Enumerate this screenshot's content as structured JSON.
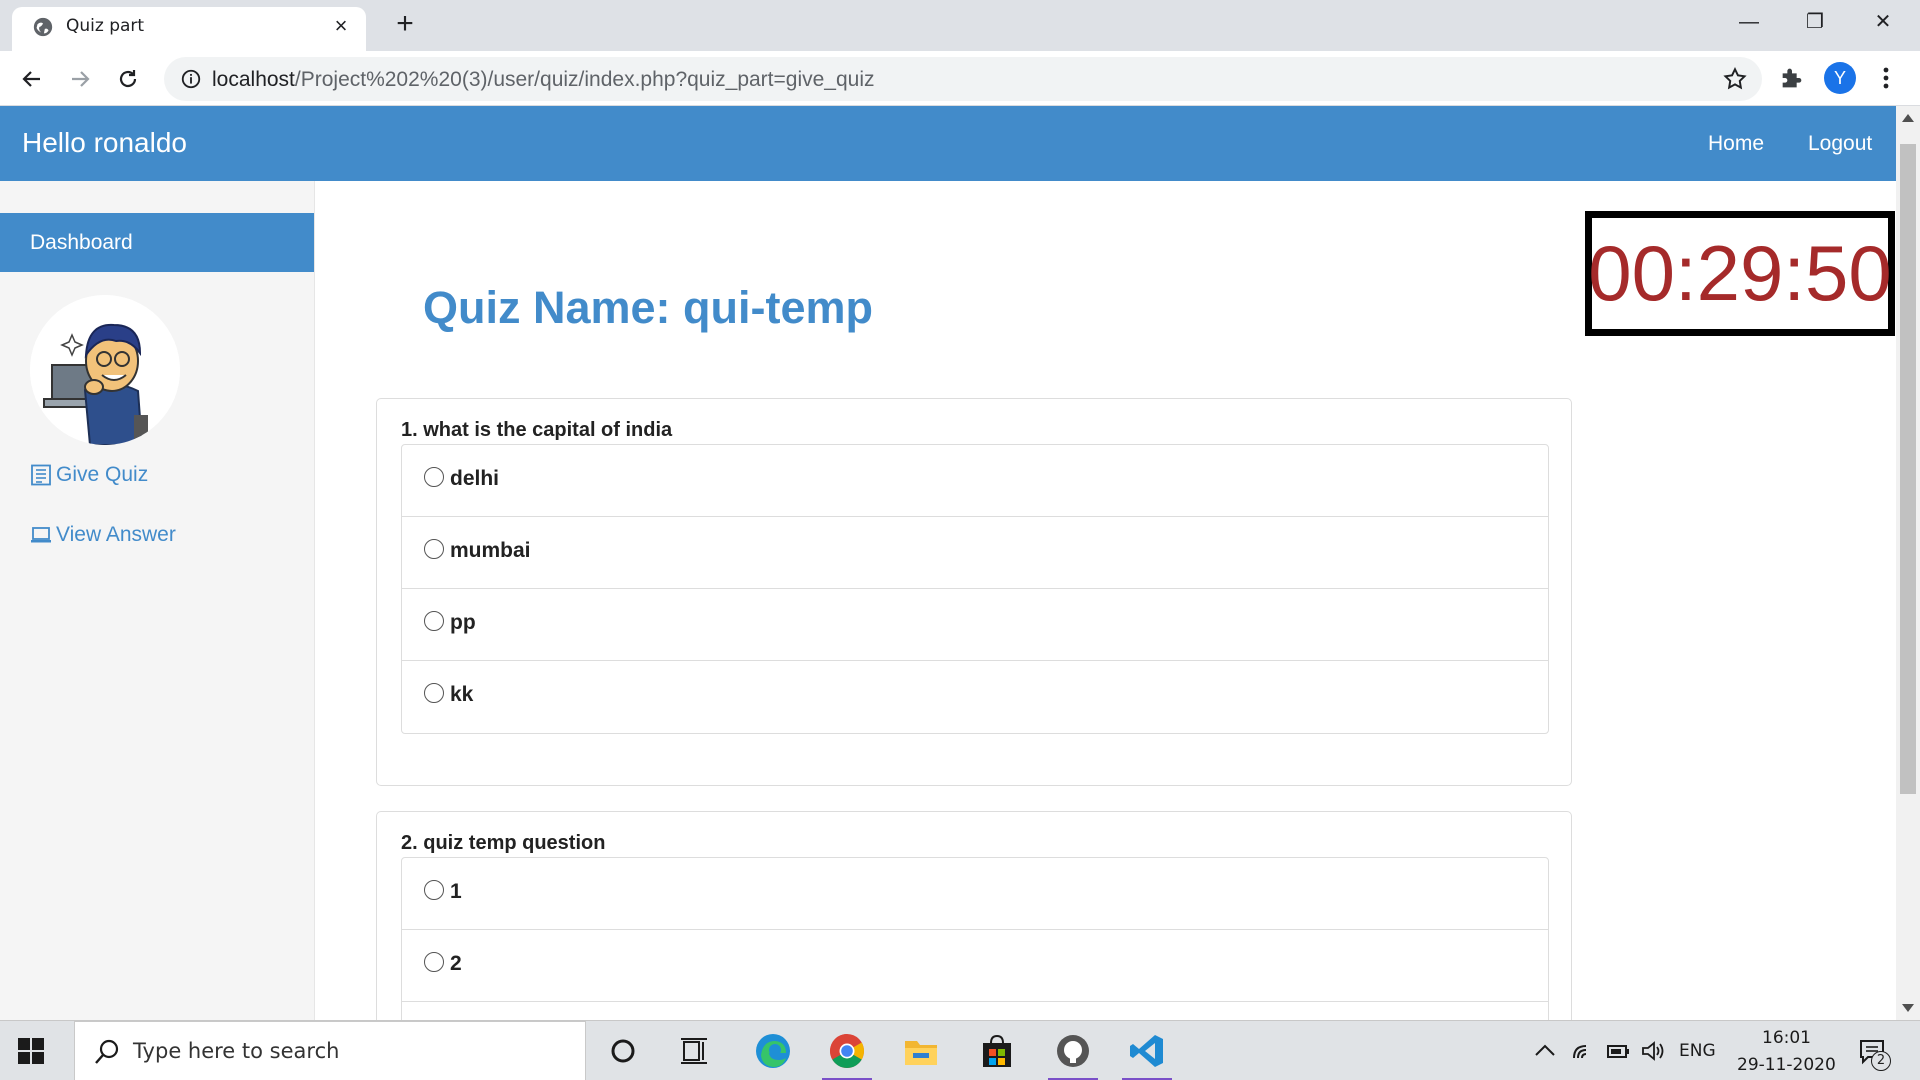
{
  "browser": {
    "tab_title": "Quiz part",
    "tab_close": "×",
    "new_tab": "+",
    "url_host": "localhost",
    "url_path": "/Project%202%20(3)/user/quiz/index.php?quiz_part=give_quiz",
    "profile_initial": "Y",
    "window_controls": {
      "minimize": "—",
      "restore": "❐",
      "close": "✕"
    }
  },
  "topnav": {
    "brand": "Hello ronaldo",
    "links": [
      "Home",
      "Logout"
    ]
  },
  "sidebar": {
    "active": "Dashboard",
    "links": [
      {
        "label": "Give Quiz",
        "icon": "list-icon"
      },
      {
        "label": "View Answer",
        "icon": "laptop-icon"
      }
    ]
  },
  "quiz": {
    "title": "Quiz Name: qui-temp",
    "timer": "00:29:50",
    "questions": [
      {
        "text": "1. what is the capital of india",
        "options": [
          "delhi",
          "mumbai",
          "pp",
          "kk"
        ]
      },
      {
        "text": "2. quiz temp question",
        "options": [
          "1",
          "2"
        ]
      }
    ]
  },
  "taskbar": {
    "search_placeholder": "Type here to search",
    "language": "ENG",
    "time": "16:01",
    "date": "29-11-2020",
    "notification_count": "2"
  },
  "colors": {
    "primary": "#428bca",
    "timer_text": "#a52a2a"
  }
}
